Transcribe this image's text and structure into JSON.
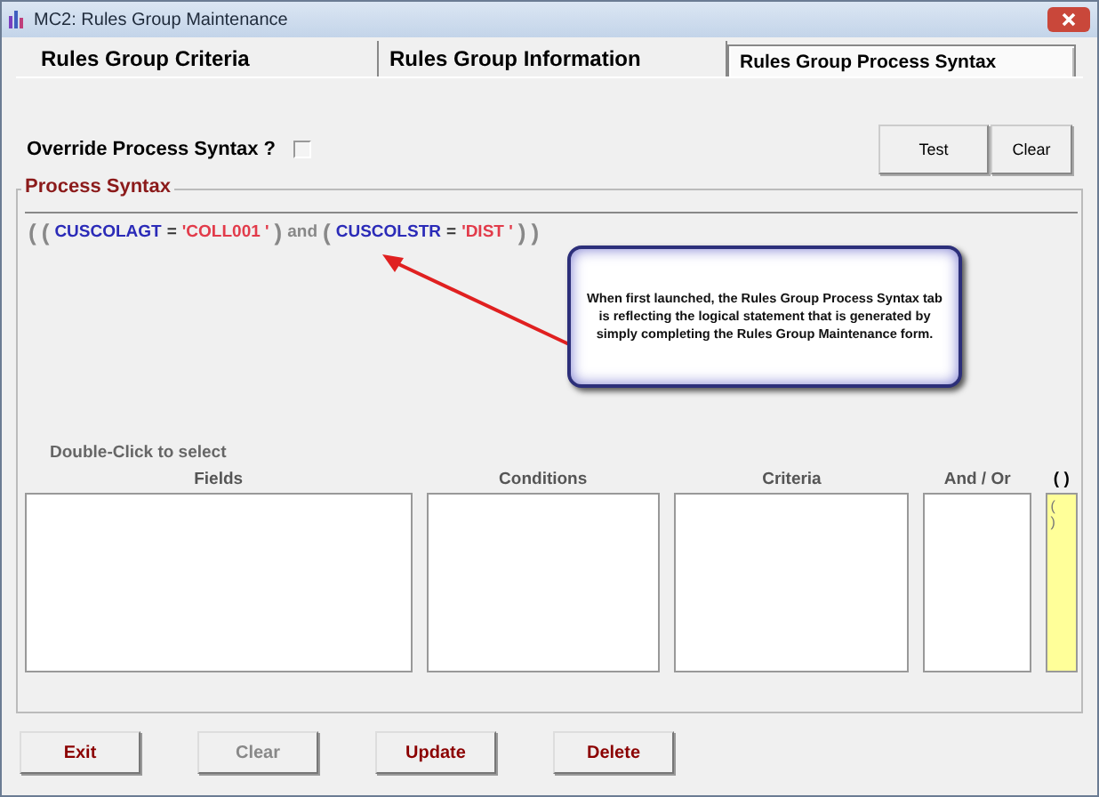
{
  "window": {
    "title": "MC2: Rules Group Maintenance"
  },
  "tabs": [
    {
      "label": "Rules Group Criteria",
      "selected": false
    },
    {
      "label": "Rules Group Information",
      "selected": false
    },
    {
      "label": "Rules Group Process Syntax",
      "selected": true
    }
  ],
  "override": {
    "label": "Override Process Syntax ?",
    "checked": false
  },
  "top_buttons": [
    {
      "label": "Test",
      "disabled": false
    },
    {
      "label": "Clear",
      "disabled": false
    }
  ],
  "process_syntax": {
    "title": "Process Syntax",
    "tokens": [
      {
        "kind": "paren",
        "text": "("
      },
      {
        "kind": "paren",
        "text": "("
      },
      {
        "kind": "field",
        "text": "CUSCOLAGT"
      },
      {
        "kind": "op",
        "text": "="
      },
      {
        "kind": "value",
        "text": "'COLL001 '"
      },
      {
        "kind": "paren",
        "text": ")"
      },
      {
        "kind": "keyword",
        "text": "and"
      },
      {
        "kind": "paren",
        "text": "("
      },
      {
        "kind": "field",
        "text": "CUSCOLSTR"
      },
      {
        "kind": "op",
        "text": "="
      },
      {
        "kind": "value",
        "text": "'DIST '"
      },
      {
        "kind": "paren",
        "text": ")"
      },
      {
        "kind": "paren",
        "text": ")"
      }
    ]
  },
  "callout": {
    "text": "When first launched, the Rules Group Process Syntax tab is reflecting the logical statement that is generated by simply completing the Rules Group Maintenance form."
  },
  "hint": "Double-Click to select",
  "lists": [
    {
      "heading": "Fields",
      "kind": "plain"
    },
    {
      "heading": "Conditions",
      "kind": "plain"
    },
    {
      "heading": "Criteria",
      "kind": "plain"
    },
    {
      "heading": "And / Or",
      "kind": "plain"
    },
    {
      "heading": "( )",
      "kind": "paren",
      "items": [
        "(",
        ")"
      ]
    }
  ],
  "bottom_buttons": [
    {
      "label": "Exit",
      "disabled": false
    },
    {
      "label": "Clear",
      "disabled": true
    },
    {
      "label": "Update",
      "disabled": false
    },
    {
      "label": "Delete",
      "disabled": false
    }
  ]
}
